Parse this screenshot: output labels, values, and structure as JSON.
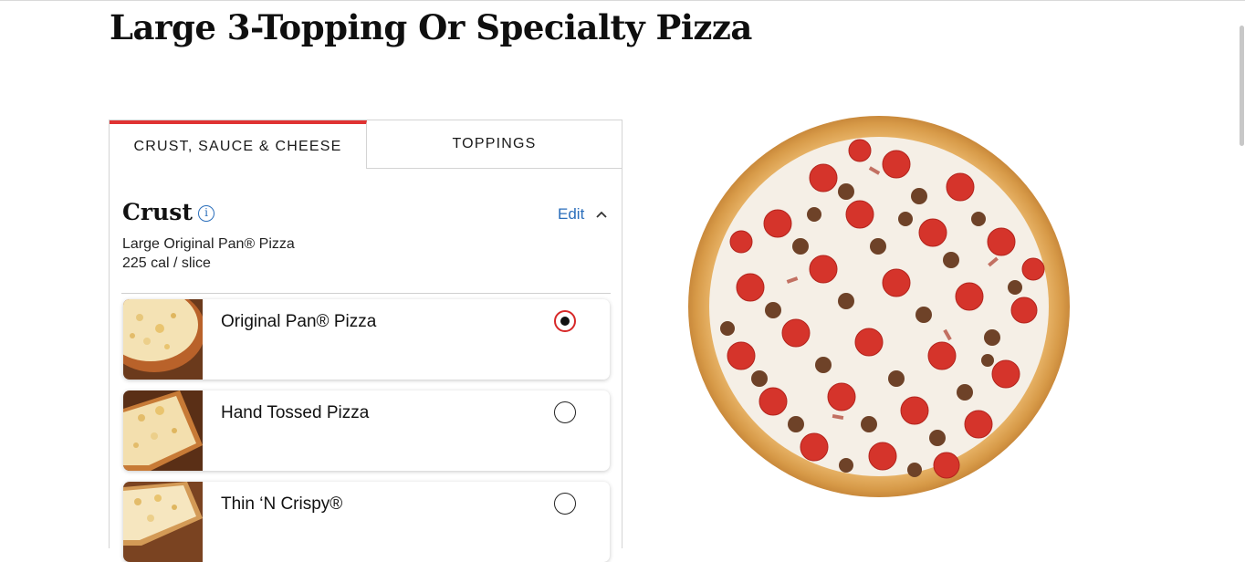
{
  "page": {
    "title": "Large 3-Topping Or Specialty Pizza"
  },
  "tabs": [
    {
      "label": "CRUST, SAUCE & CHEESE",
      "active": true
    },
    {
      "label": "TOPPINGS",
      "active": false
    }
  ],
  "crust": {
    "heading": "Crust",
    "info_icon": "info-icon",
    "info_glyph": "i",
    "edit_label": "Edit",
    "chevron_icon": "chevron-up-icon",
    "selected_name": "Large Original Pan® Pizza",
    "calories": "225 cal / slice",
    "options": [
      {
        "label": "Original Pan® Pizza",
        "selected": true
      },
      {
        "label": "Hand Tossed Pizza",
        "selected": false
      },
      {
        "label": "Thin ‘N Crispy®",
        "selected": false
      }
    ]
  },
  "colors": {
    "accent_red": "#e03232",
    "link_blue": "#2a6ebb"
  }
}
